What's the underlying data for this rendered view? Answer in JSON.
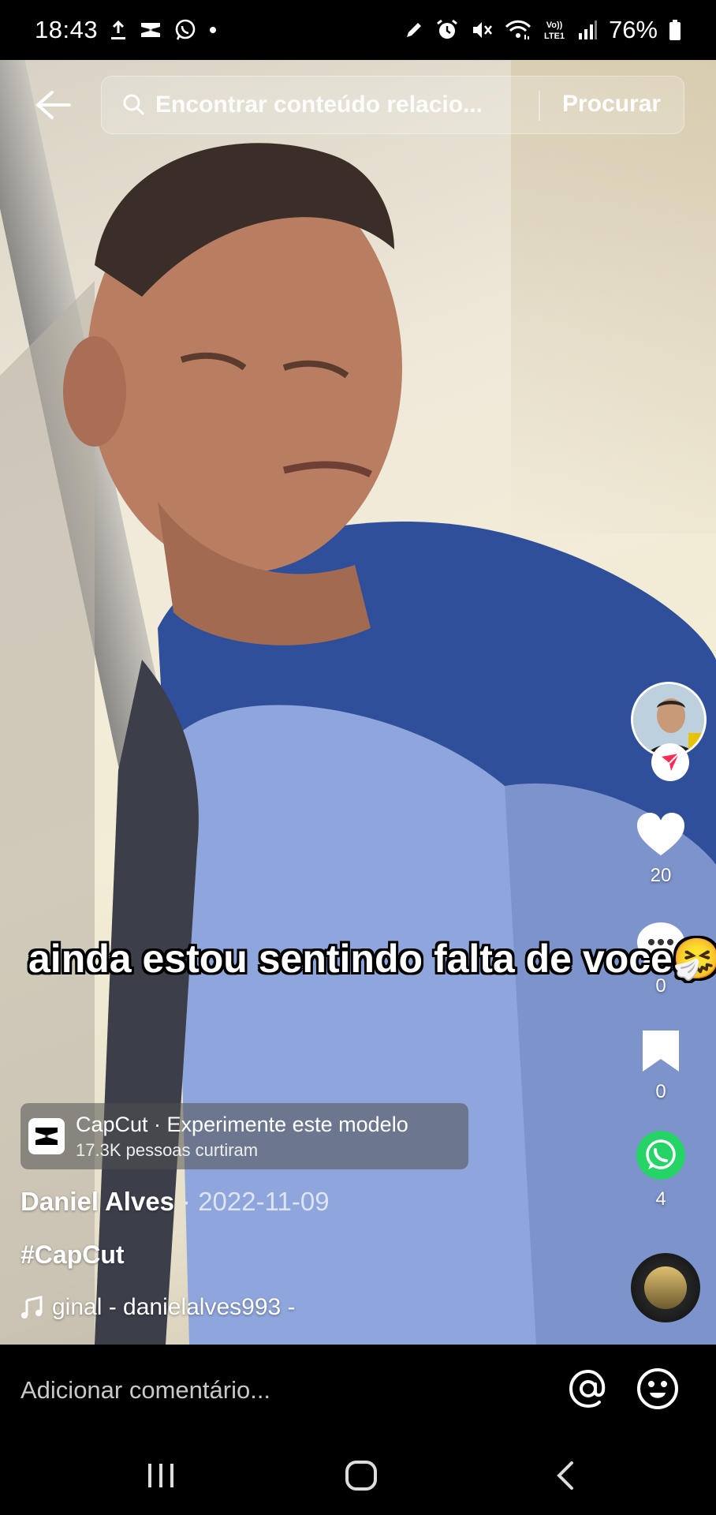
{
  "status_bar": {
    "time": "18:43",
    "battery": "76%",
    "left_icons": [
      "upload-icon",
      "capcut-notif-icon",
      "whatsapp-notif-icon",
      "dot-icon"
    ],
    "right_icons": [
      "pen-icon",
      "alarm-icon",
      "mute-icon",
      "wifi-icon",
      "volte-icon",
      "signal-icon",
      "battery-icon"
    ]
  },
  "search": {
    "placeholder": "Encontrar conteúdo relacio...",
    "submit_label": "Procurar"
  },
  "video": {
    "caption": "ainda estou sentindo falta de voce",
    "caption_emoji": "🤧"
  },
  "rail": {
    "likes": "20",
    "comments": "0",
    "saves": "0",
    "shares": "4"
  },
  "capcut_banner": {
    "title": "CapCut · Experimente este modelo",
    "subtitle": "17.3K pessoas curtiram"
  },
  "author": {
    "name": "Daniel Alves",
    "date": "· 2022-11-09",
    "hashtag": "#CapCut",
    "music": "ginal - danielalves993 -"
  },
  "comment_bar": {
    "placeholder": "Adicionar comentário..."
  },
  "colors": {
    "accent": "#fe2c55",
    "whatsapp": "#25d366",
    "background": "#000000"
  }
}
